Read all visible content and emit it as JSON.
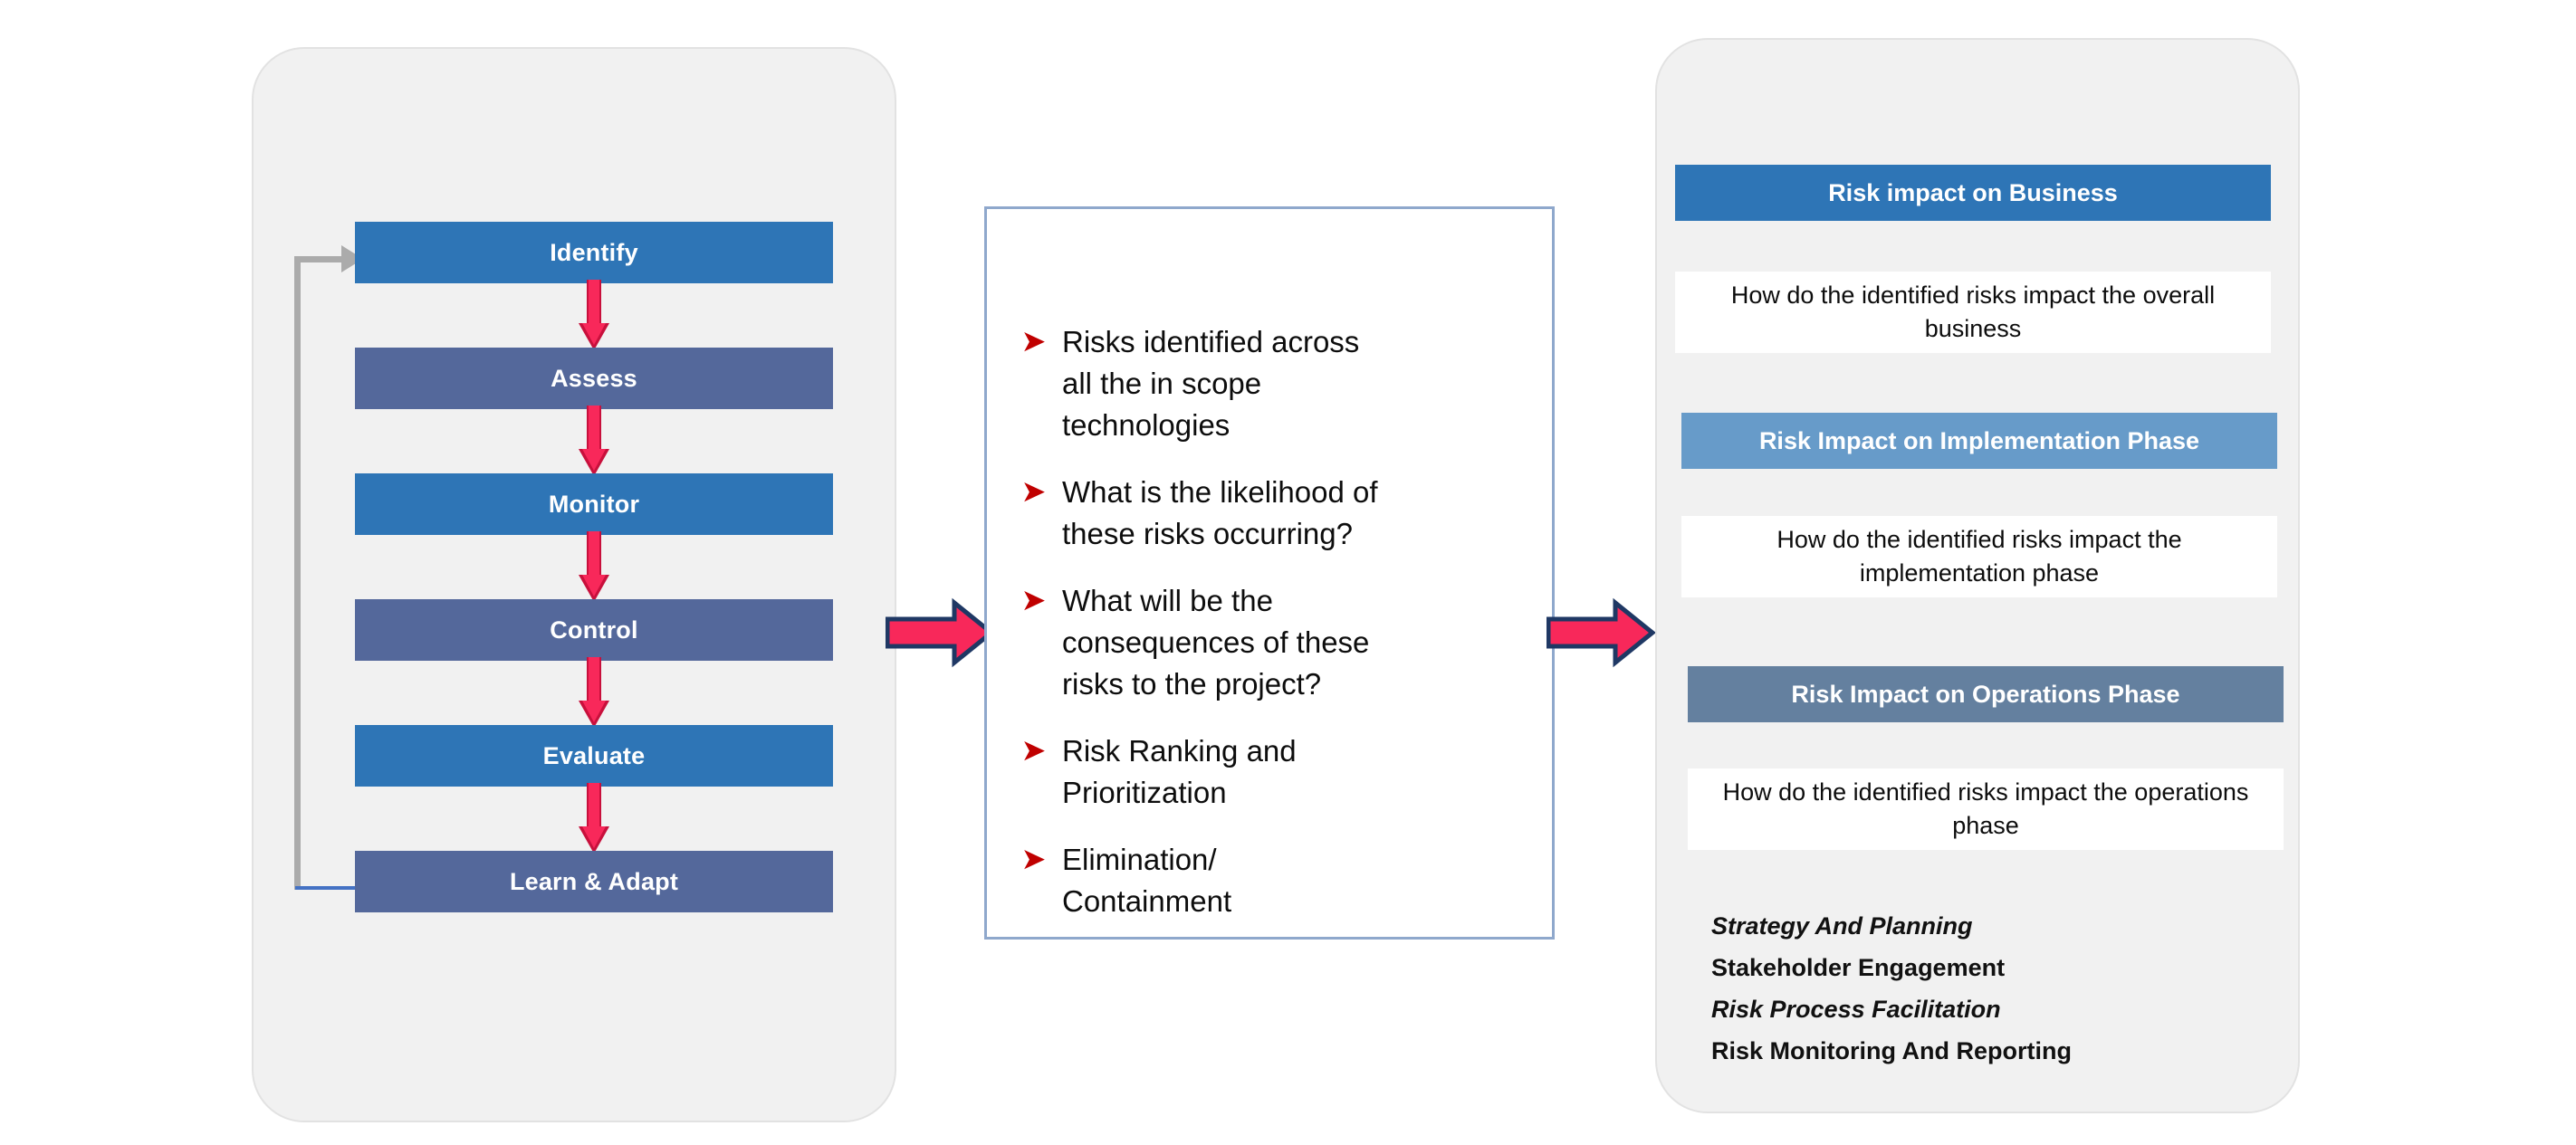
{
  "diagram": {
    "title": "Risk Management Process Flow",
    "colors": {
      "primary_blue": "#2E75B6",
      "slate_blue": "#54689B",
      "light_blue": "#679BC9",
      "steel_blue": "#64809F",
      "accent_pink": "#F8285A",
      "arrow_outline": "#1F3864",
      "loop_gray": "#ABABAB",
      "loop_blue": "#4472C4",
      "bullet_red": "#C00000",
      "panel_bg": "#F1F1F1",
      "card_border": "#8FA8CC"
    }
  },
  "left_panel": {
    "name": "risk-process-cycle",
    "steps": [
      {
        "label": "Identify",
        "style": "blue"
      },
      {
        "label": "Assess",
        "style": "slate"
      },
      {
        "label": "Monitor",
        "style": "blue"
      },
      {
        "label": "Control",
        "style": "slate"
      },
      {
        "label": "Evaluate",
        "style": "blue"
      },
      {
        "label": "Learn & Adapt",
        "style": "slate"
      }
    ],
    "feedback_loop": "Learn & Adapt returns to Identify"
  },
  "middle_panel": {
    "name": "risk-questions-card",
    "bullet_marker": "➤",
    "bullets": [
      "Risks identified across\nall the in scope\ntechnologies",
      "What is the likelihood of\nthese risks occurring?",
      "What will be the\nconsequences of these\nrisks to the project?",
      "Risk Ranking and\nPrioritization",
      "Elimination/\nContainment"
    ]
  },
  "right_panel": {
    "name": "risk-impact-panel",
    "impacts": [
      {
        "header": "Risk impact on Business",
        "body": "How do the identified risks impact the overall business"
      },
      {
        "header": "Risk Impact on Implementation Phase",
        "body": "How do the identified risks impact the implementation phase"
      },
      {
        "header": "Risk Impact on Operations Phase",
        "body": "How do the identified risks impact the operations phase"
      }
    ],
    "footer_items": [
      {
        "label": "Strategy And Planning",
        "italic": true
      },
      {
        "label": "Stakeholder Engagement",
        "italic": false
      },
      {
        "label": "Risk Process Facilitation",
        "italic": true
      },
      {
        "label": "Risk Monitoring And Reporting",
        "italic": false
      }
    ]
  },
  "connectors": {
    "arrow_1_label": "process-to-questions",
    "arrow_2_label": "questions-to-impact"
  }
}
